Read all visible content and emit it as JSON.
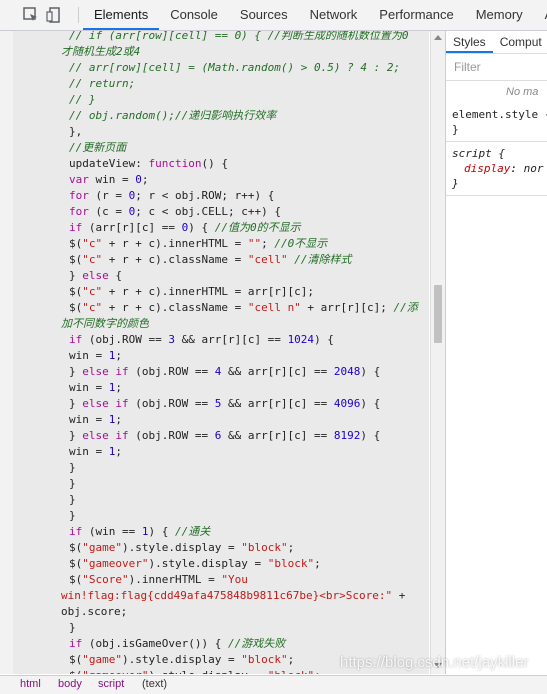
{
  "devtools": {
    "tabs": [
      "Elements",
      "Console",
      "Sources",
      "Network",
      "Performance",
      "Memory",
      "Appl"
    ],
    "active_tab": "Elements"
  },
  "code_lines": [
    {
      "indent": "    ",
      "segs": [
        [
          "cmt",
          "// if (arr[row][cell] == 0) { //判断生成的随机数位置为0"
        ]
      ]
    },
    {
      "indent": "",
      "segs": [
        [
          "cmt",
          "才随机生成2或4"
        ]
      ]
    },
    {
      "indent": "    ",
      "segs": [
        [
          "cmt",
          "// arr[row][cell] = (Math.random() > 0.5) ? 4 : 2;"
        ]
      ]
    },
    {
      "indent": "    ",
      "segs": [
        [
          "cmt",
          "// return;"
        ]
      ]
    },
    {
      "indent": "    ",
      "segs": [
        [
          "cmt",
          "// }"
        ]
      ]
    },
    {
      "indent": "    ",
      "segs": [
        [
          "cmt",
          "// obj.random();//递归影响执行效率"
        ]
      ]
    },
    {
      "indent": "  ",
      "segs": [
        [
          "",
          "},"
        ]
      ]
    },
    {
      "indent": "  ",
      "segs": [
        [
          "cmt",
          "//更新页面"
        ]
      ]
    },
    {
      "indent": "  ",
      "segs": [
        [
          "",
          "updateView: "
        ],
        [
          "kw",
          "function"
        ],
        [
          "",
          "() {"
        ]
      ]
    },
    {
      "indent": "  ",
      "segs": [
        [
          "kw",
          "var"
        ],
        [
          "",
          " win = "
        ],
        [
          "num",
          "0"
        ],
        [
          "",
          ";"
        ]
      ]
    },
    {
      "indent": "  ",
      "segs": [
        [
          "kw",
          "for"
        ],
        [
          "",
          " (r = "
        ],
        [
          "num",
          "0"
        ],
        [
          "",
          "; r < obj.ROW; r++) {"
        ]
      ]
    },
    {
      "indent": "  ",
      "segs": [
        [
          "kw",
          "for"
        ],
        [
          "",
          " (c = "
        ],
        [
          "num",
          "0"
        ],
        [
          "",
          "; c < obj.CELL; c++) {"
        ]
      ]
    },
    {
      "indent": "  ",
      "segs": [
        [
          "kw",
          "if"
        ],
        [
          "",
          " (arr[r][c] == "
        ],
        [
          "num",
          "0"
        ],
        [
          "",
          ") { "
        ],
        [
          "cmt",
          "//值为0的不显示"
        ]
      ]
    },
    {
      "indent": "  ",
      "segs": [
        [
          "",
          "$("
        ],
        [
          "str",
          "\"c\""
        ],
        [
          "",
          " + r + c).innerHTML = "
        ],
        [
          "str",
          "\"\""
        ],
        [
          "",
          "; "
        ],
        [
          "cmt",
          "//0不显示"
        ]
      ]
    },
    {
      "indent": "  ",
      "segs": [
        [
          "",
          "$("
        ],
        [
          "str",
          "\"c\""
        ],
        [
          "",
          " + r + c).className = "
        ],
        [
          "str",
          "\"cell\""
        ],
        [
          "",
          " "
        ],
        [
          "cmt",
          "//清除样式"
        ]
      ]
    },
    {
      "indent": "  ",
      "segs": [
        [
          "",
          "} "
        ],
        [
          "kw",
          "else"
        ],
        [
          "",
          " {"
        ]
      ]
    },
    {
      "indent": "  ",
      "segs": [
        [
          "",
          "$("
        ],
        [
          "str",
          "\"c\""
        ],
        [
          "",
          " + r + c).innerHTML = arr[r][c];"
        ]
      ]
    },
    {
      "indent": "  ",
      "segs": [
        [
          "",
          "$("
        ],
        [
          "str",
          "\"c\""
        ],
        [
          "",
          " + r + c).className = "
        ],
        [
          "str",
          "\"cell n\""
        ],
        [
          "",
          " + arr[r][c]; "
        ],
        [
          "cmt",
          "//添"
        ]
      ]
    },
    {
      "indent": "",
      "segs": [
        [
          "cmt",
          "加不同数字的颜色"
        ]
      ]
    },
    {
      "indent": "  ",
      "segs": [
        [
          "kw",
          "if"
        ],
        [
          "",
          " (obj.ROW == "
        ],
        [
          "num",
          "3"
        ],
        [
          "",
          " && arr[r][c] == "
        ],
        [
          "num",
          "1024"
        ],
        [
          "",
          ") {"
        ]
      ]
    },
    {
      "indent": "  ",
      "segs": [
        [
          "",
          "win = "
        ],
        [
          "num",
          "1"
        ],
        [
          "",
          ";"
        ]
      ]
    },
    {
      "indent": "  ",
      "segs": [
        [
          "",
          "} "
        ],
        [
          "kw",
          "else if"
        ],
        [
          "",
          " (obj.ROW == "
        ],
        [
          "num",
          "4"
        ],
        [
          "",
          " && arr[r][c] == "
        ],
        [
          "num",
          "2048"
        ],
        [
          "",
          ") {"
        ]
      ]
    },
    {
      "indent": "  ",
      "segs": [
        [
          "",
          "win = "
        ],
        [
          "num",
          "1"
        ],
        [
          "",
          ";"
        ]
      ]
    },
    {
      "indent": "  ",
      "segs": [
        [
          "",
          "} "
        ],
        [
          "kw",
          "else if"
        ],
        [
          "",
          " (obj.ROW == "
        ],
        [
          "num",
          "5"
        ],
        [
          "",
          " && arr[r][c] == "
        ],
        [
          "num",
          "4096"
        ],
        [
          "",
          ") {"
        ]
      ]
    },
    {
      "indent": "  ",
      "segs": [
        [
          "",
          "win = "
        ],
        [
          "num",
          "1"
        ],
        [
          "",
          ";"
        ]
      ]
    },
    {
      "indent": "  ",
      "segs": [
        [
          "",
          "} "
        ],
        [
          "kw",
          "else if"
        ],
        [
          "",
          " (obj.ROW == "
        ],
        [
          "num",
          "6"
        ],
        [
          "",
          " && arr[r][c] == "
        ],
        [
          "num",
          "8192"
        ],
        [
          "",
          ") {"
        ]
      ]
    },
    {
      "indent": "  ",
      "segs": [
        [
          "",
          "win = "
        ],
        [
          "num",
          "1"
        ],
        [
          "",
          ";"
        ]
      ]
    },
    {
      "indent": "  ",
      "segs": [
        [
          "",
          "}"
        ]
      ]
    },
    {
      "indent": "  ",
      "segs": [
        [
          "",
          "}"
        ]
      ]
    },
    {
      "indent": "  ",
      "segs": [
        [
          "",
          "}"
        ]
      ]
    },
    {
      "indent": "  ",
      "segs": [
        [
          "",
          "}"
        ]
      ]
    },
    {
      "indent": "  ",
      "segs": [
        [
          "kw",
          "if"
        ],
        [
          "",
          " (win == "
        ],
        [
          "num",
          "1"
        ],
        [
          "",
          ") { "
        ],
        [
          "cmt",
          "//通关"
        ]
      ]
    },
    {
      "indent": "  ",
      "segs": [
        [
          "",
          "$("
        ],
        [
          "str",
          "\"game\""
        ],
        [
          "",
          ").style.display = "
        ],
        [
          "str",
          "\"block\""
        ],
        [
          "",
          ";"
        ]
      ]
    },
    {
      "indent": "  ",
      "segs": [
        [
          "",
          "$("
        ],
        [
          "str",
          "\"gameover\""
        ],
        [
          "",
          ").style.display = "
        ],
        [
          "str",
          "\"block\""
        ],
        [
          "",
          ";"
        ]
      ]
    },
    {
      "indent": "  ",
      "segs": [
        [
          "",
          "$("
        ],
        [
          "str",
          "\"Score\""
        ],
        [
          "",
          ").innerHTML = "
        ],
        [
          "str",
          "\"You"
        ]
      ]
    },
    {
      "indent": "",
      "segs": [
        [
          "str",
          "win!flag:flag{cdd49afa475848b9811c67be}<br>Score:\""
        ],
        [
          "",
          " +"
        ]
      ]
    },
    {
      "indent": "",
      "segs": [
        [
          "",
          "obj.score;"
        ]
      ]
    },
    {
      "indent": "  ",
      "segs": [
        [
          "",
          "}"
        ]
      ]
    },
    {
      "indent": "  ",
      "segs": [
        [
          "kw",
          "if"
        ],
        [
          "",
          " (obj.isGameOver()) { "
        ],
        [
          "cmt",
          "//游戏失败"
        ]
      ]
    },
    {
      "indent": "  ",
      "segs": [
        [
          "",
          "$("
        ],
        [
          "str",
          "\"game\""
        ],
        [
          "",
          ").style.display = "
        ],
        [
          "str",
          "\"block\""
        ],
        [
          "",
          ";"
        ]
      ]
    },
    {
      "indent": "  ",
      "segs": [
        [
          "",
          "$("
        ],
        [
          "str",
          "\"gameover\""
        ],
        [
          "",
          ").style.display = "
        ],
        [
          "str",
          "\"block\""
        ],
        [
          "",
          ";"
        ]
      ]
    }
  ],
  "styles_panel": {
    "tabs": [
      "Styles",
      "Comput"
    ],
    "filter_placeholder": "Filter",
    "no_match": "No ma",
    "element_style": "element.style {",
    "element_close": "}",
    "rule_selector": "script {",
    "rule_prop": "display",
    "rule_value": "nor",
    "rule_close": "}"
  },
  "breadcrumbs": [
    "html",
    "body",
    "script",
    "(text)"
  ],
  "watermark": "https://blog.csdn.net/jaykiller",
  "colors": {
    "active_tab": "#1a73e8",
    "comment": "#236e25",
    "keyword": "#aa0d91",
    "string": "#c41a16"
  }
}
